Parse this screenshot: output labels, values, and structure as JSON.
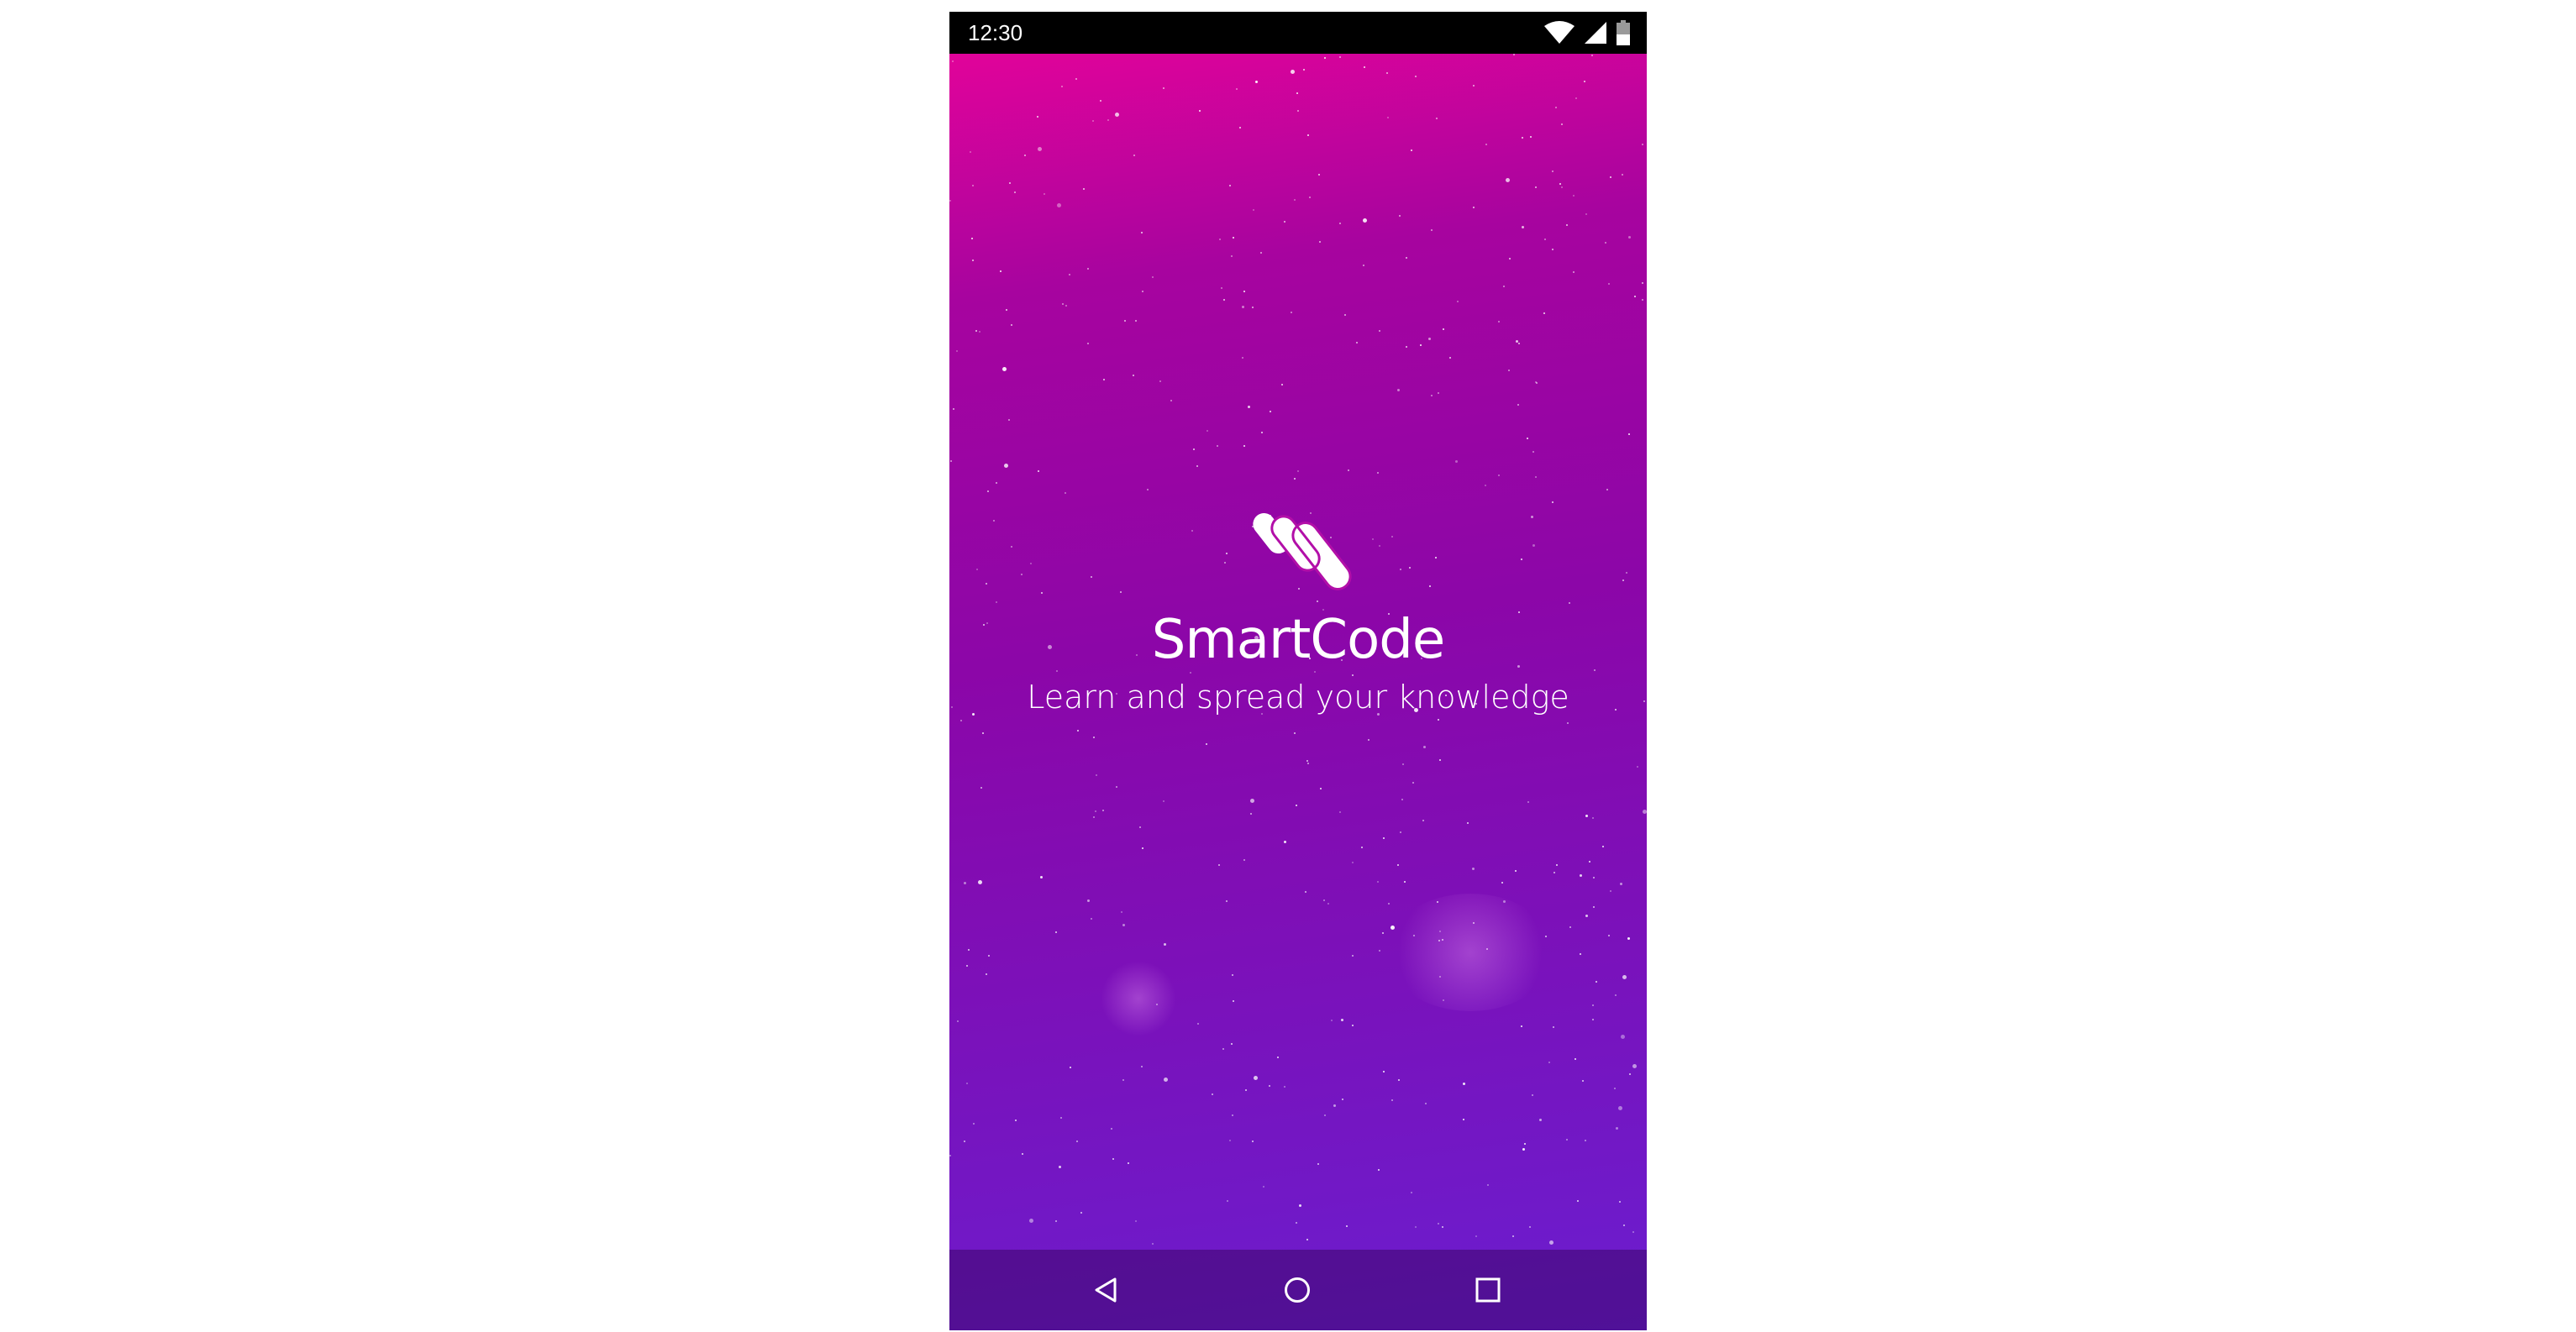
{
  "status_bar": {
    "time": "12:30",
    "icons": [
      "wifi-icon",
      "cellular-signal-icon",
      "battery-icon"
    ]
  },
  "splash": {
    "logo_icon": "smartcode-logo-icon",
    "app_name": "SmartCode",
    "tagline": "Learn and spread your knowledge"
  },
  "nav_bar": {
    "buttons": [
      "back-icon",
      "home-icon",
      "recents-icon"
    ]
  },
  "colors": {
    "gradient_top": "#e1039a",
    "gradient_mid": "#8c06a8",
    "gradient_bottom": "#6a1ed0",
    "text": "#ffffff",
    "status_bar_bg": "#000000"
  }
}
